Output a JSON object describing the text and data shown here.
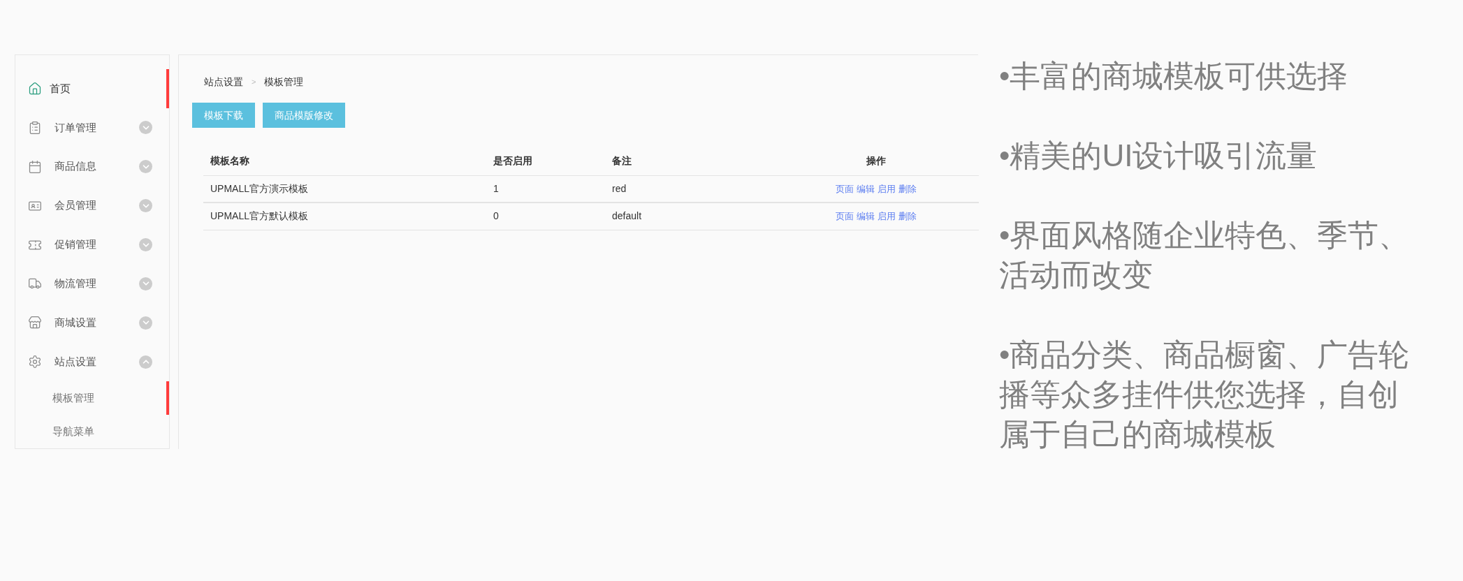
{
  "sidebar": {
    "items": [
      {
        "label": "首页",
        "selected": true
      },
      {
        "label": "订单管理",
        "selected": false,
        "expanded": false
      },
      {
        "label": "商品信息",
        "selected": false,
        "expanded": false
      },
      {
        "label": "会员管理",
        "selected": false,
        "expanded": false
      },
      {
        "label": "促销管理",
        "selected": false,
        "expanded": false
      },
      {
        "label": "物流管理",
        "selected": false,
        "expanded": false
      },
      {
        "label": "商城设置",
        "selected": false,
        "expanded": false
      },
      {
        "label": "站点设置",
        "selected": false,
        "expanded": true,
        "children": [
          {
            "label": "模板管理",
            "selected": true
          },
          {
            "label": "导航菜单",
            "selected": false
          }
        ]
      }
    ]
  },
  "breadcrumb": [
    "站点设置",
    "模板管理"
  ],
  "breadcrumb_separator": ">",
  "buttons": [
    "模板下载",
    "商品模版修改"
  ],
  "table": {
    "columns": [
      "模板名称",
      "是否启用",
      "备注",
      "操作"
    ],
    "rows": [
      {
        "name": "UPMALL官方演示模板",
        "enabled": "1",
        "note": "red",
        "actions": [
          "页面",
          "编辑",
          "启用",
          "删除"
        ]
      },
      {
        "name": "UPMALL官方默认模板",
        "enabled": "0",
        "note": "default",
        "actions": [
          "页面",
          "编辑",
          "启用",
          "删除"
        ]
      }
    ]
  },
  "features": [
    "•丰富的商城模板可供选择",
    "•精美的UI设计吸引流量",
    "•界面风格随企业特色、季节、活动而改变",
    "•商品分类、商品橱窗、广告轮播等众多挂件供您选择，自创属于自己的商城模板"
  ]
}
